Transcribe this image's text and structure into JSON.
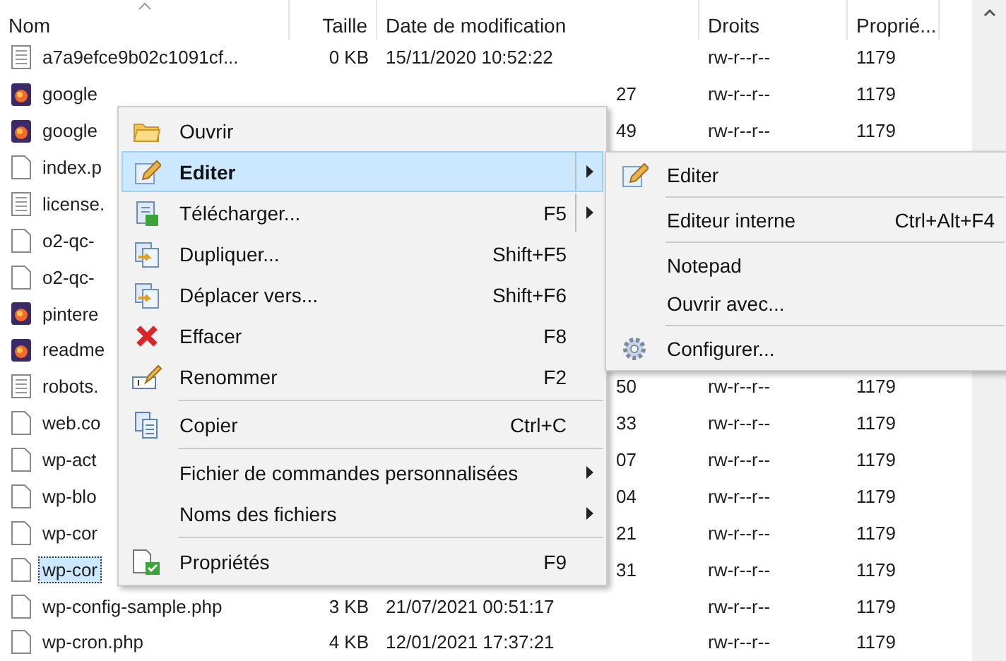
{
  "table": {
    "columns": [
      "Nom",
      "Taille",
      "Date de modification",
      "Droits",
      "Proprié..."
    ],
    "rows": [
      {
        "kind": "text",
        "name": "a7a9efce9b02c1091cf...",
        "size": "0 KB",
        "date": "15/11/2020 10:52:22",
        "rights": "rw-r--r--",
        "owner": "1179",
        "selected": false
      },
      {
        "kind": "web",
        "name": "google",
        "date_tail": "27",
        "rights": "rw-r--r--",
        "owner": "1179",
        "selected": false
      },
      {
        "kind": "web",
        "name": "google",
        "date_tail": "49",
        "rights": "rw-r--r--",
        "owner": "1179",
        "selected": false
      },
      {
        "kind": "blank",
        "name": "index.p",
        "selected": false
      },
      {
        "kind": "text",
        "name": "license.",
        "selected": false
      },
      {
        "kind": "blank",
        "name": "o2-qc-",
        "selected": false
      },
      {
        "kind": "blank",
        "name": "o2-qc-",
        "selected": false
      },
      {
        "kind": "web",
        "name": "pintere",
        "selected": false
      },
      {
        "kind": "web",
        "name": "readme",
        "selected": false
      },
      {
        "kind": "text",
        "name": "robots.",
        "date_tail": "50",
        "rights": "rw-r--r--",
        "owner": "1179",
        "selected": false
      },
      {
        "kind": "blank",
        "name": "web.co",
        "date_tail": "33",
        "rights": "rw-r--r--",
        "owner": "1179",
        "selected": false
      },
      {
        "kind": "blank",
        "name": "wp-act",
        "date_tail": "07",
        "rights": "rw-r--r--",
        "owner": "1179",
        "selected": false
      },
      {
        "kind": "blank",
        "name": "wp-blo",
        "date_tail": "04",
        "rights": "rw-r--r--",
        "owner": "1179",
        "selected": false
      },
      {
        "kind": "blank",
        "name": "wp-cor",
        "date_tail": "21",
        "rights": "rw-r--r--",
        "owner": "1179",
        "selected": false
      },
      {
        "kind": "blank",
        "name": "wp-cor",
        "date_tail": "31",
        "rights": "rw-r--r--",
        "owner": "1179",
        "selected": true
      },
      {
        "kind": "blank",
        "name": "wp-config-sample.php",
        "size": "3 KB",
        "date": "21/07/2021 00:51:17",
        "rights": "rw-r--r--",
        "owner": "1179",
        "selected": false
      },
      {
        "kind": "blank",
        "name": "wp-cron.php",
        "size": "4 KB",
        "date": "12/01/2021 17:37:21",
        "rights": "rw-r--r--",
        "owner": "1179",
        "selected": false
      }
    ]
  },
  "context_menu": {
    "items": [
      {
        "kind": "folder",
        "label": "Ouvrir",
        "selected": false,
        "default": false
      },
      {
        "kind": "pencil",
        "label": "Editer",
        "selected": true,
        "default": true,
        "submenu": true,
        "split": true
      },
      {
        "kind": "download",
        "label": "Télécharger...",
        "shortcut": "F5",
        "selected": false,
        "default": false,
        "submenu": true,
        "split": true
      },
      {
        "kind": "copy",
        "label": "Dupliquer...",
        "shortcut": "Shift+F5",
        "selected": false,
        "default": false
      },
      {
        "kind": "copy",
        "label": "Déplacer vers...",
        "shortcut": "Shift+F6",
        "selected": false,
        "default": false
      },
      {
        "kind": "delete",
        "label": "Effacer",
        "shortcut": "F8",
        "selected": false,
        "default": false
      },
      {
        "kind": "rename",
        "label": "Renommer",
        "shortcut": "F2",
        "selected": false,
        "default": false
      },
      {
        "kind": "separator"
      },
      {
        "kind": "clipboard",
        "label": "Copier",
        "shortcut": "Ctrl+C",
        "selected": false,
        "default": false
      },
      {
        "kind": "separator"
      },
      {
        "kind": "plain",
        "label": "Fichier de commandes personnalisées",
        "selected": false,
        "default": false,
        "submenu": true
      },
      {
        "kind": "plain",
        "label": "Noms des fichiers",
        "selected": false,
        "default": false,
        "submenu": true
      },
      {
        "kind": "separator"
      },
      {
        "kind": "properties",
        "label": "Propriétés",
        "shortcut": "F9",
        "selected": false,
        "default": false
      }
    ]
  },
  "submenu": {
    "items": [
      {
        "kind": "pencil",
        "label": "Editer",
        "selected": false
      },
      {
        "kind": "separator"
      },
      {
        "kind": "plain",
        "label": "Editeur interne",
        "shortcut": "Ctrl+Alt+F4",
        "selected": false
      },
      {
        "kind": "separator"
      },
      {
        "kind": "plain",
        "label": "Notepad",
        "selected": false
      },
      {
        "kind": "plain",
        "label": "Ouvrir avec...",
        "selected": false
      },
      {
        "kind": "separator"
      },
      {
        "kind": "gear",
        "label": "Configurer...",
        "selected": false
      }
    ]
  }
}
